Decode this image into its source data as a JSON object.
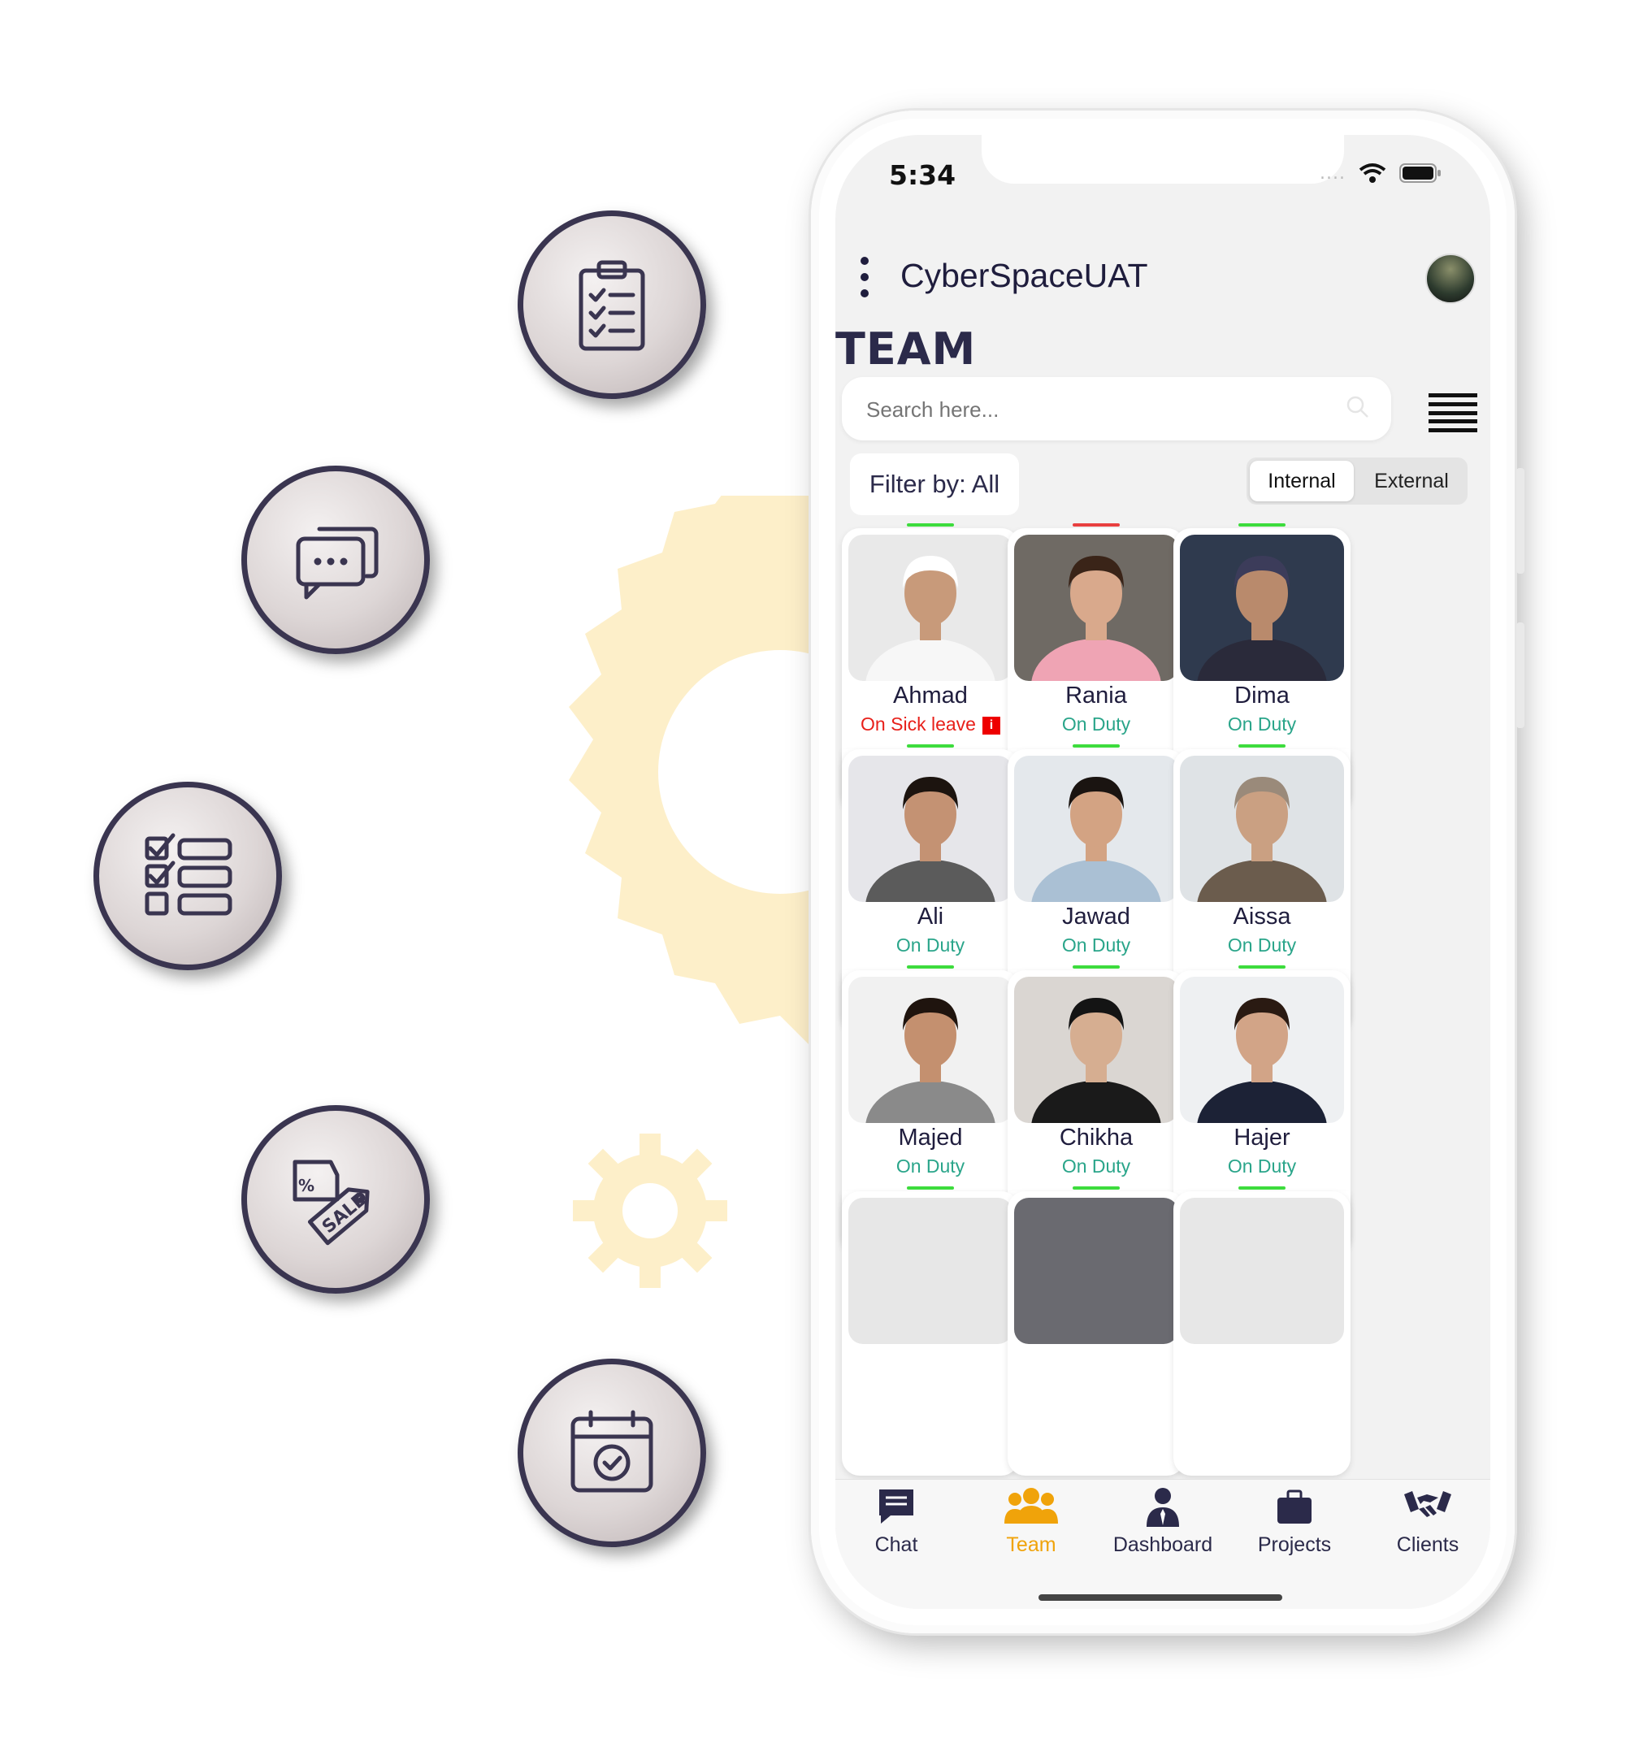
{
  "status_bar": {
    "time": "5:34"
  },
  "header": {
    "app_name": "CyberSpaceUAT",
    "page_title": "TEAM"
  },
  "search": {
    "placeholder": "Search here..."
  },
  "filter": {
    "label": "Filter by: All"
  },
  "segmented": {
    "internal": "Internal",
    "external": "External",
    "selected": "Internal"
  },
  "colors": {
    "on_duty": "#2aa58a",
    "sick": "#e8201a",
    "status_green": "#3ddc3d",
    "status_red": "#e84040",
    "accent_orange": "#f0a30a",
    "doc_green": "#1d7a45",
    "navy": "#2b2a4a"
  },
  "team": [
    {
      "name": "Ahmad",
      "status": "On Sick leave",
      "indicator": "red-info",
      "bar": "green"
    },
    {
      "name": "Rania",
      "status": "On Duty",
      "bar": "red"
    },
    {
      "name": "Dima",
      "status": "On Duty",
      "bar": "green"
    },
    {
      "name": "Ali",
      "status": "On Duty",
      "bar": "green"
    },
    {
      "name": "Jawad",
      "status": "On Duty",
      "bar": "green"
    },
    {
      "name": "Aissa",
      "status": "On Duty",
      "bar": "green"
    },
    {
      "name": "Majed",
      "status": "On Duty",
      "bar": "green"
    },
    {
      "name": "Chikha",
      "status": "On Duty",
      "bar": "green"
    },
    {
      "name": "Hajer",
      "status": "On Duty",
      "bar": "green"
    }
  ],
  "tabs": [
    {
      "label": "Chat",
      "icon": "chat-icon"
    },
    {
      "label": "Team",
      "icon": "team-icon",
      "active": true
    },
    {
      "label": "Dashboard",
      "icon": "dashboard-icon"
    },
    {
      "label": "Projects",
      "icon": "briefcase-icon"
    },
    {
      "label": "Clients",
      "icon": "handshake-icon"
    }
  ],
  "feature_icons": [
    "clipboard-checklist-icon",
    "chat-bubbles-icon",
    "checklist-icon",
    "sale-tag-icon",
    "calendar-check-icon"
  ]
}
